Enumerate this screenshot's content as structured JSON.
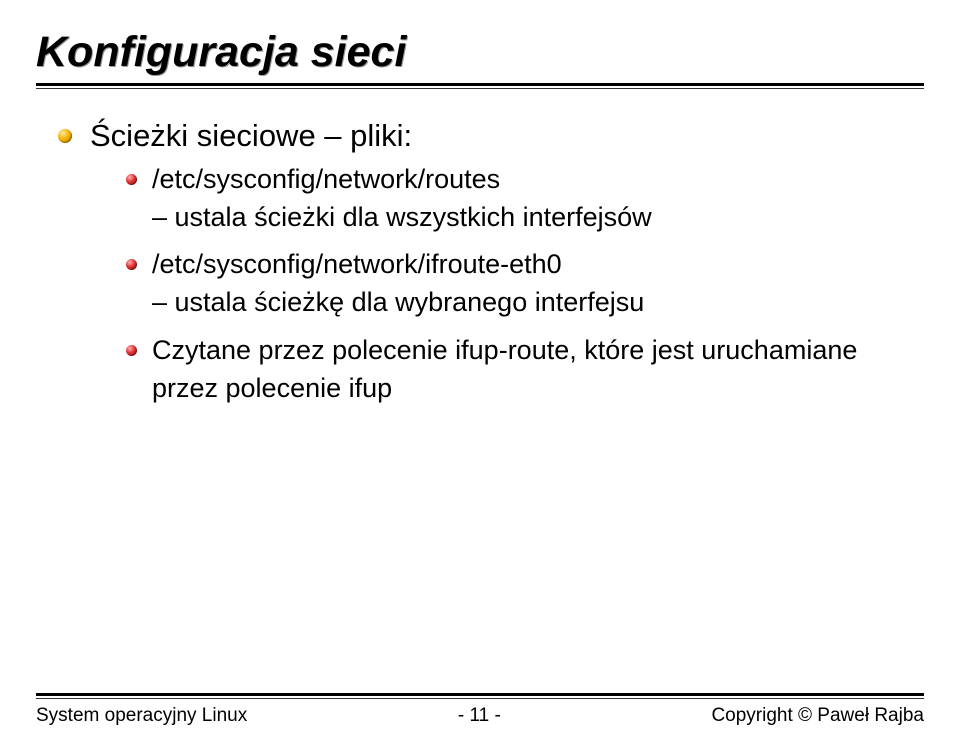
{
  "title": "Konfiguracja sieci",
  "section": "Ścieżki sieciowe – pliki:",
  "items": [
    {
      "path": "/etc/sysconfig/network/routes",
      "desc": "– ustala ścieżki dla wszystkich interfejsów"
    },
    {
      "path": "/etc/sysconfig/network/ifroute-eth0",
      "desc": "– ustala ścieżkę dla wybranego interfejsu"
    },
    {
      "path": "Czytane przez polecenie ifup-route, które jest uruchamiane przez polecenie ifup",
      "desc": ""
    }
  ],
  "footer": {
    "left": "System operacyjny Linux",
    "center": "- 11 -",
    "right": "Copyright © Paweł Rajba"
  }
}
